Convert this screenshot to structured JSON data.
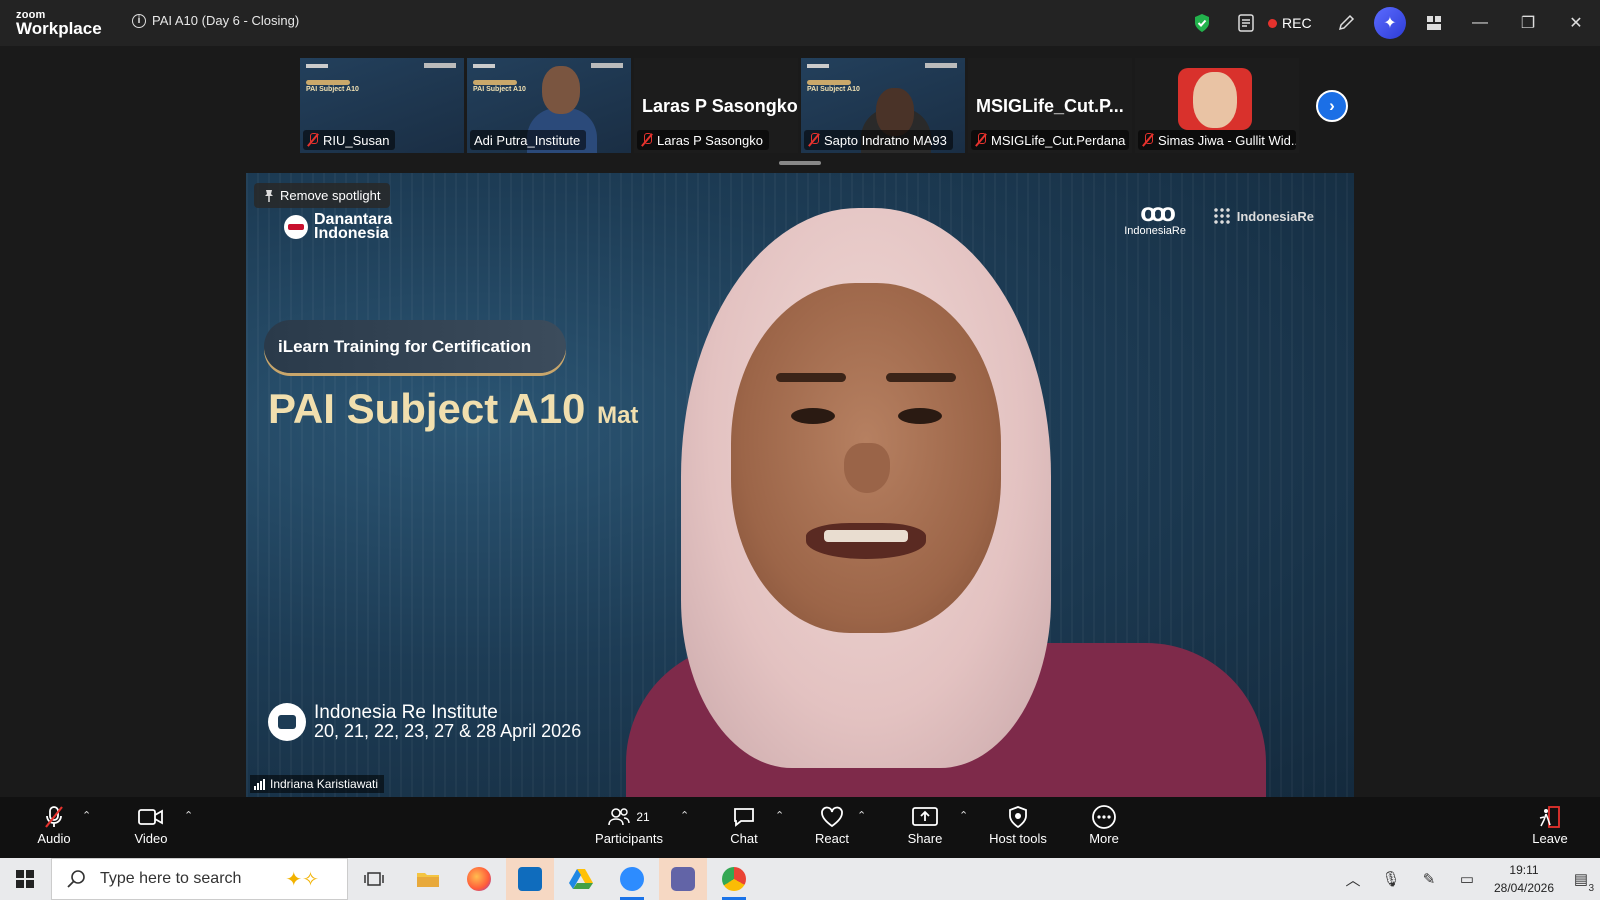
{
  "app": {
    "logo_line1": "zoom",
    "logo_line2": "Workplace",
    "meeting_title": "PAI A10 (Day 6 - Closing)",
    "rec_label": "REC"
  },
  "gallery": {
    "tiles": [
      {
        "name": "RIU_Susan",
        "type": "slide"
      },
      {
        "name": "Adi Putra_Institute",
        "type": "slide-person"
      },
      {
        "name": "Laras P Sasongko",
        "big_name": "Laras P Sasongko",
        "type": "name"
      },
      {
        "name": "Sapto Indratno MA93",
        "type": "slide-person"
      },
      {
        "name": "MSIGLife_Cut.Perdana",
        "big_name": "MSIGLife_Cut.P...",
        "type": "name"
      },
      {
        "name": "Simas Jiwa - Gullit Wid...",
        "type": "avatar"
      }
    ],
    "mini_slide_title": "PAI Subject A10"
  },
  "main": {
    "remove_spotlight": "Remove spotlight",
    "danantara": [
      "Danantara",
      "Indonesia"
    ],
    "ir_logo_label": "IndonesiaRe",
    "iri_logo_label": "IndonesiaRe",
    "pill_text": "iLearn Training for Certification",
    "subject": "PAI Subject A10",
    "subject_suffix": "Mat",
    "footer_line1": "Indonesia Re Institute",
    "footer_line2": "20, 21, 22, 23, 27 & 28 April 2026",
    "speaker": "Indriana Karistiawati"
  },
  "toolbar": {
    "audio": "Audio",
    "video": "Video",
    "participants": "Participants",
    "participants_count": "21",
    "chat": "Chat",
    "react": "React",
    "share": "Share",
    "host_tools": "Host tools",
    "more": "More",
    "leave": "Leave"
  },
  "taskbar": {
    "search_placeholder": "Type here to search",
    "time": "19:11",
    "date": "28/04/2026",
    "notif_count": "3"
  },
  "colors": {
    "accent": "#1b6fe6",
    "rec": "#e5322d",
    "mic_off": "#e5322d"
  }
}
